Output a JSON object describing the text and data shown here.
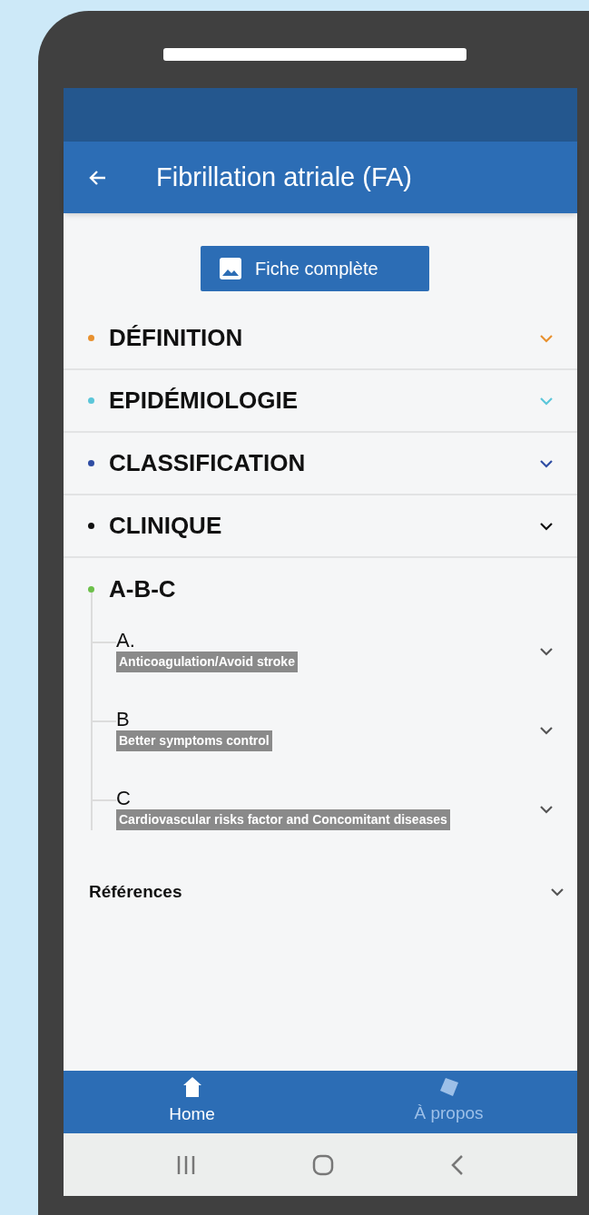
{
  "app_bar": {
    "title": "Fibrillation atriale (FA)"
  },
  "full_sheet_button": {
    "label": "Fiche complète"
  },
  "sections": [
    {
      "title": "DÉFINITION",
      "color": "#e8912f",
      "expanded": false
    },
    {
      "title": "EPIDÉMIOLOGIE",
      "color": "#5bc6d9",
      "expanded": false
    },
    {
      "title": "CLASSIFICATION",
      "color": "#2f4da3",
      "expanded": false
    },
    {
      "title": "CLINIQUE",
      "color": "#111111",
      "expanded": false
    },
    {
      "title": "A-B-C",
      "color": "#6cc04a",
      "expanded": true,
      "children": [
        {
          "letter": "A.",
          "description": "Anticoagulation/Avoid stroke"
        },
        {
          "letter": "B",
          "description": "Better symptoms control"
        },
        {
          "letter": "C",
          "description": "Cardiovascular risks factor and Concomitant diseases"
        }
      ]
    }
  ],
  "references": {
    "title": "Références"
  },
  "bottom_nav": [
    {
      "label": "Home",
      "kind": "home",
      "selected": true
    },
    {
      "label": "À propos",
      "kind": "about",
      "selected": false
    }
  ]
}
